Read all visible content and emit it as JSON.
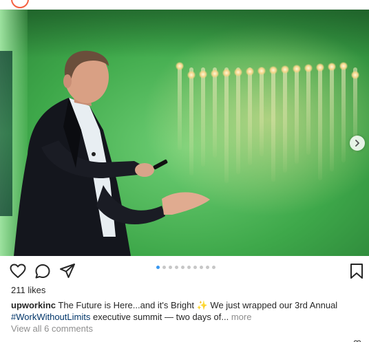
{
  "post": {
    "likes": "211 likes",
    "caption": {
      "username": "upworkinc",
      "text_before_emoji": "The Future is Here...and it's Bright",
      "emoji": "✨",
      "text_after_emoji": "We just wrapped our 3rd Annual",
      "hashtag": "#WorkWithoutLimits",
      "text_after_hashtag": "executive summit — two days of...",
      "more_label": "more"
    },
    "view_comments": "View all 6 comments",
    "carousel": {
      "total_slides": 10,
      "active_index": 0
    },
    "icons": {
      "like": "heart-icon",
      "comment": "comment-icon",
      "share": "share-icon",
      "save": "bookmark-icon",
      "next": "chevron-right-icon"
    },
    "colors": {
      "active_dot": "#3897f0",
      "inactive_dot": "#c7c7c7",
      "hashtag": "#003569",
      "muted": "#8e8e8e",
      "avatar_ring": "#f56040"
    }
  }
}
